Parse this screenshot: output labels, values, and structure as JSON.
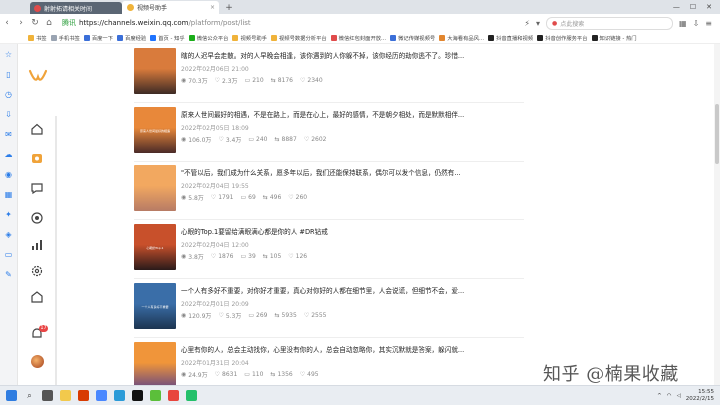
{
  "browser": {
    "tab_inactive": "射射拓请相关时间",
    "tab_active": "视频号助手",
    "secure_label": "腾讯",
    "url_host": "https://channels.weixin.qq.com",
    "url_path": "/platform/post/list",
    "search_placeholder": "点此搜索",
    "bookmarks": [
      {
        "label": "书签",
        "color": "#f0b33a"
      },
      {
        "label": "手机书签",
        "color": "#9aa4b2"
      },
      {
        "label": "百度一下",
        "color": "#3b6fd8"
      },
      {
        "label": "百度经验",
        "color": "#3b6fd8"
      },
      {
        "label": "首页 - 知乎",
        "color": "#1e73ff"
      },
      {
        "label": "微信公众平台",
        "color": "#1aad19"
      },
      {
        "label": "视频号助手",
        "color": "#f0b33a"
      },
      {
        "label": "视频号数据分析平台",
        "color": "#f0b33a"
      },
      {
        "label": "微信红包封面开放...",
        "color": "#e04b4b"
      },
      {
        "label": "微记传媒视频号",
        "color": "#3b6fd8"
      },
      {
        "label": "大海看有品风...",
        "color": "#e2862f"
      },
      {
        "label": "抖音直播和视频",
        "color": "#222"
      },
      {
        "label": "抖音创作服务平台",
        "color": "#222"
      },
      {
        "label": "知识链接 - 热门",
        "color": "#222"
      }
    ]
  },
  "posts": [
    {
      "title": "瞎的人迟早会走散。对的人早晚会相逢，该你遇到的人你躲不掉，该你经历的劫你逃不了。珍惜...",
      "date": "2022年02月06日 21:00",
      "views": "70.3万",
      "likes": "2.3万",
      "comments": "210",
      "shares": "8176",
      "favs": "2340",
      "colors": [
        "#d97b3c",
        "#3d2a25"
      ],
      "caption": ""
    },
    {
      "title": "原来人世间最好的相遇，不是在路上，而是在心上，最好的感情，不是朝夕相处，而是默默相伴...",
      "date": "2022年02月05日 18:09",
      "views": "106.0万",
      "likes": "3.4万",
      "comments": "240",
      "shares": "8887",
      "favs": "2602",
      "colors": [
        "#e8883a",
        "#4a2a28"
      ],
      "caption": "原来人世间最好的相遇"
    },
    {
      "title": "\"不管以后，我们成为什么关系，愿多年以后，我们还能保持联系，偶尔可以发个信息，仍然有...",
      "date": "2022年02月04日 19:55",
      "views": "5.8万",
      "likes": "1791",
      "comments": "69",
      "shares": "496",
      "favs": "260",
      "colors": [
        "#f2a860",
        "#b77b65"
      ],
      "caption": ""
    },
    {
      "title": "心眼的Top.1要留给满眼满心都是你的人 #DR钻戒",
      "date": "2022年02月04日 12:00",
      "views": "3.8万",
      "likes": "1876",
      "comments": "39",
      "shares": "105",
      "favs": "126",
      "colors": [
        "#c8502b",
        "#2a1a1a"
      ],
      "caption": "心眼的Top.1"
    },
    {
      "title": "一个人有多好不重要，对你好才重要，真心对你好的人都在细节里，人会说谎，但细节不会，爱...",
      "date": "2022年02月01日 20:09",
      "views": "120.9万",
      "likes": "5.3万",
      "comments": "269",
      "shares": "5935",
      "favs": "2555",
      "colors": [
        "#3a6ea8",
        "#1c3450"
      ],
      "caption": "一个人有多好不重要"
    },
    {
      "title": "心里有你的人，总会主动找你，心里没有你的人，总会自动忽略你，其实沉默就是答案，躲闪就...",
      "date": "2022年01月31日 20:04",
      "views": "24.9万",
      "likes": "8631",
      "comments": "110",
      "shares": "1356",
      "favs": "495",
      "colors": [
        "#f0953a",
        "#6b4a80"
      ],
      "caption": ""
    }
  ],
  "sidebar": {
    "notif_count": "17"
  },
  "watermark": "知乎 @楠果收藏",
  "taskbar": {
    "time": "15:55",
    "date": "2022/2/15"
  }
}
